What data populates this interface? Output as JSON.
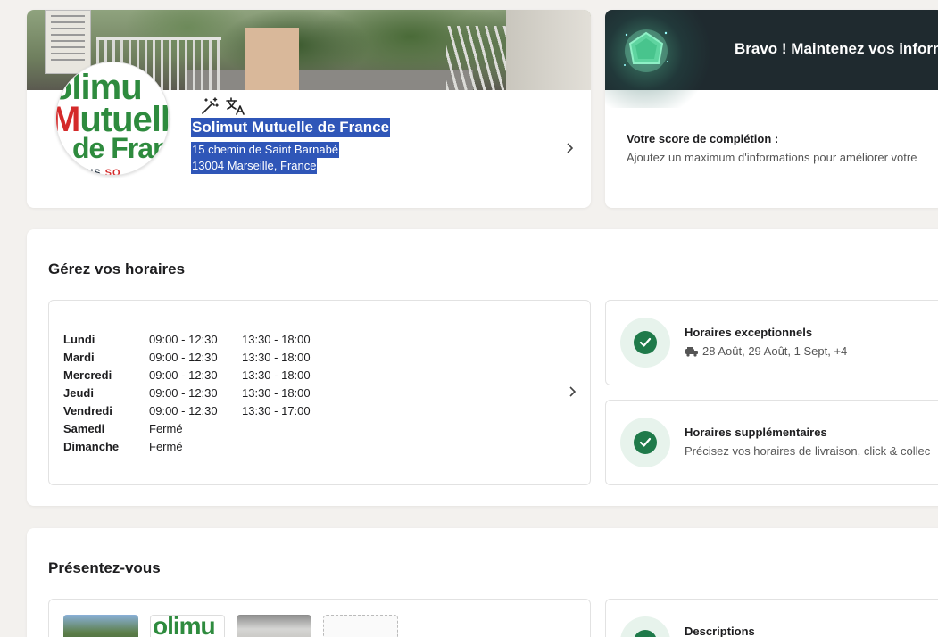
{
  "business": {
    "name": "Solimut Mutuelle de France",
    "address_line1": "15 chemin de Saint Barnabé",
    "address_line2": "13004 Marseille, France",
    "logo": {
      "line1": "olimu",
      "line2": "utuell",
      "line3": "de Fran",
      "line4a": "TIONS ",
      "line4b": "SO"
    }
  },
  "toolbar": {
    "icons": [
      "magic-wand-icon",
      "translate-icon"
    ]
  },
  "score": {
    "banner": "Bravo ! Maintenez vos inform",
    "title": "Votre score de complétion :",
    "subtitle": "Ajoutez un maximum d'informations pour améliorer votre"
  },
  "hours": {
    "title": "Gérez vos horaires",
    "days": [
      {
        "day": "Lundi",
        "slot1": "09:00 - 12:30",
        "slot2": "13:30 - 18:00"
      },
      {
        "day": "Mardi",
        "slot1": "09:00 - 12:30",
        "slot2": "13:30 - 18:00"
      },
      {
        "day": "Mercredi",
        "slot1": "09:00 - 12:30",
        "slot2": "13:30 - 18:00"
      },
      {
        "day": "Jeudi",
        "slot1": "09:00 - 12:30",
        "slot2": "13:30 - 18:00"
      },
      {
        "day": "Vendredi",
        "slot1": "09:00 - 12:30",
        "slot2": "13:30 - 17:00"
      },
      {
        "day": "Samedi",
        "slot1": "Fermé",
        "slot2": ""
      },
      {
        "day": "Dimanche",
        "slot1": "Fermé",
        "slot2": ""
      }
    ],
    "exceptional": {
      "title": "Horaires exceptionnels",
      "dates": "28 Août, 29 Août, 1 Sept, +4"
    },
    "additional": {
      "title": "Horaires supplémentaires",
      "subtitle": "Précisez vos horaires de livraison, click & collec"
    }
  },
  "present": {
    "title": "Présentez-vous",
    "thumb2_text": "olimu",
    "descriptions_title": "Descriptions"
  },
  "colors": {
    "accent_green": "#1f7a4a",
    "selection_blue": "#2f56b8",
    "banner_dark": "#1f2a2f"
  }
}
